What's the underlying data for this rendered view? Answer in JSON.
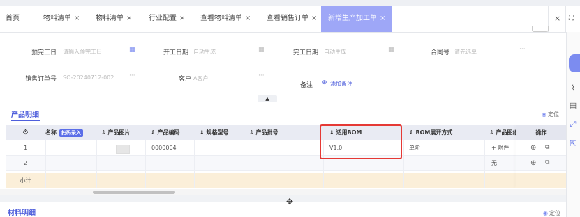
{
  "tabs": [
    {
      "label": "首页",
      "closable": false
    },
    {
      "label": "物料清单",
      "closable": true
    },
    {
      "label": "物料清单",
      "closable": true
    },
    {
      "label": "行业配置",
      "closable": true
    },
    {
      "label": "查看物料清单",
      "closable": true
    },
    {
      "label": "查看销售订单",
      "closable": true
    },
    {
      "label": "新增生产加工单",
      "closable": true,
      "active": true
    }
  ],
  "tab_close_glyph": "×",
  "window_close_glyph": "×",
  "window_fullscreen_glyph": "⛶",
  "form": {
    "due_date": {
      "label": "预完工日",
      "placeholder": "请输入预完工日"
    },
    "start_date": {
      "label": "开工日期",
      "placeholder": "自动生成"
    },
    "finish_date": {
      "label": "完工日期",
      "placeholder": "自动生成"
    },
    "contract_no": {
      "label": "合同号",
      "placeholder": "请先选单"
    },
    "sales_order": {
      "label": "销售订单号",
      "value": "SO-20240712-002"
    },
    "customer": {
      "label": "客户",
      "value": "A客户"
    },
    "remark": {
      "label": "备注",
      "add_label": "添加备注"
    },
    "more_glyph": "···",
    "collapse_glyph": "▲"
  },
  "product_section": {
    "title": "产品明细",
    "locate_label": "定位",
    "scan_button": "扫码录入",
    "columns": [
      "名称",
      "产品图片",
      "产品编码",
      "规格型号",
      "产品批号",
      "适用BOM",
      "BOM展开方式",
      "产品图纸",
      "操作"
    ],
    "rows": [
      {
        "index": "1",
        "code": "0000004",
        "bom": "V1.0",
        "expand": "单阶",
        "drawing": "+ 附件"
      },
      {
        "index": "2",
        "code": "",
        "bom": "",
        "expand": "",
        "drawing": "无"
      }
    ],
    "subtotal_label": "小计",
    "sort_glyph": "⇕",
    "settings_glyph": "⚙",
    "add_row_glyph": "⊕",
    "copy_glyph": "⧉"
  },
  "material_section": {
    "title": "材料明细",
    "locate_label": "定位"
  },
  "move_handle_glyph": "✥",
  "colors": {
    "accent": "#4f5fdc",
    "active_tab": "#9ea7f7",
    "highlight": "#e53935",
    "subtotal_bg": "#fbefd9"
  }
}
